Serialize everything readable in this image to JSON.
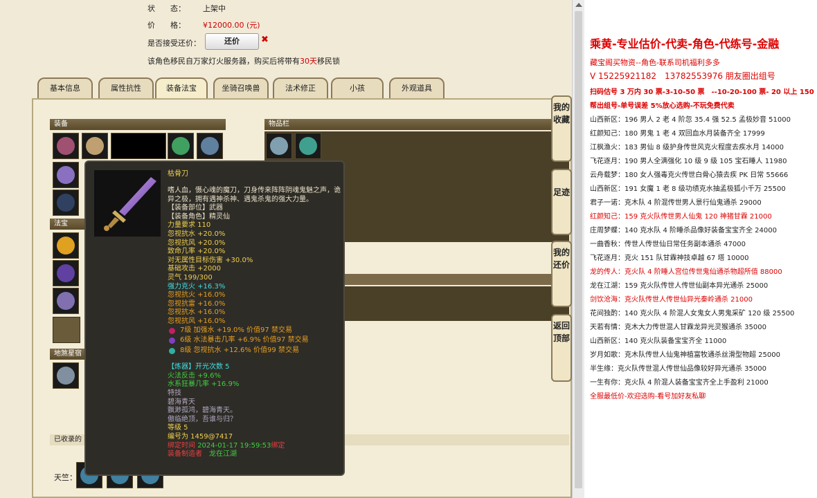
{
  "trade_info": {
    "status_label": "状　　态：",
    "status_value": "上架中",
    "price_label": "价　　格：",
    "price_value": "¥12000.00 (元)",
    "accept_offer_label": "是否接受还价：",
    "offer_button": "还价",
    "offer_x": "✖",
    "migration_prefix": "该角色移民自万家灯火服务器，购买后将带有",
    "migration_days": "30天",
    "migration_suffix": "移民锁"
  },
  "tabs": [
    "基本信息",
    "属性抗性",
    "装备法宝",
    "坐骑召唤兽",
    "法术修正",
    "小孩",
    "外观道具"
  ],
  "sections": {
    "equipment": "装备",
    "inventory": "物品栏",
    "treasure": "法宝",
    "reserved": "地煞星宿",
    "collected": "已收录的",
    "tianzhu": "天竺："
  },
  "side_buttons": [
    "我的收藏",
    "足迹",
    "我的还价",
    "返回顶部"
  ],
  "tooltip": {
    "name": "枯骨刀",
    "desc": "嗜人血，慑心魂的魔刀，刀身传来阵阵阴魂鬼魅之声，诡异之极，拥有遇神杀神、遇鬼杀鬼的强大力量。",
    "slot": "【装备部位】武器",
    "role": "【装备角色】精灵仙",
    "power_req": "力量要求 110",
    "stats_white": [
      "忽视抗水 +20.0%",
      "忽视抗风 +20.0%",
      "致命几率 +20.0%",
      "对无属性目标伤害 +30.0%",
      "基础攻击 +2000",
      "灵气 199/300"
    ],
    "stat_cyan": "强力克火 +16.3%",
    "stats_orange": [
      "忽视抗火 +16.0%",
      "忽视抗雷 +16.0%",
      "忽视抗水 +16.0%",
      "忽视抗风 +16.0%"
    ],
    "gems": [
      "7级 加强水 +19.0% 价值97 禁交易",
      "6级 水法暴击几率 +6.9% 价值97 禁交易",
      "8级 忽视抗水 +12.6% 价值99 禁交易"
    ],
    "forge_label": "【炼器】",
    "forge_value": "开光次数 5",
    "forge_stats": [
      "火法反击 +9.6%",
      "水系狂暴几率 +16.9%"
    ],
    "skill_label": "特技",
    "skill_name": "碧海青天",
    "poem": [
      "飘渺孤鸿，碧海青天。",
      "傲临绝顶，吾谁与归？"
    ],
    "level": "等级 5",
    "serial": "编号为 1459@7417",
    "bound_label": "绑定时间",
    "bound_time": "2024-01-17 19:59:53",
    "bound_tag": "绑定",
    "maker_label": "装备制造者",
    "maker": "龙在江湖"
  },
  "right_panel": {
    "title": "乘黄-专业估价-代卖-角色-代练号-金融",
    "sub1": "藏宝阁买物资--角色-联系司机福利多多",
    "phone": "V 15225921182　13782553976 朋友圈出组号",
    "promo1": "扫码估号 3 万内 30 票-3-10-50 票　--10-20-100 票- 20 以上 150",
    "promo2": "帮出组号-单号误差 5%放心选购-不玩免费代卖",
    "listings": [
      {
        "text": "山西新区：196 男人 2 老 4 阶忽 35.4 强 52.5 孟极妙音 51000",
        "red": false
      },
      {
        "text": "红颜知己：180 男鬼 1 老 4 双回血水月装备齐全 17999",
        "red": false
      },
      {
        "text": "江枫渔火：183 男仙 8 级护身传世风克火程度去疾水月 14000",
        "red": false
      },
      {
        "text": "飞花逐月：190 男人全满强化 10 级 9 级 105 宝石睡人 11980",
        "red": false
      },
      {
        "text": "云舟载梦：180 女人强毒克火传世白骨心猿去疾 PK 日常 55666",
        "red": false
      },
      {
        "text": "山西新区：191 女魔 1 老 8 级功绩克水抽孟极狐小千万 25500",
        "red": false
      },
      {
        "text": "君子一诺：克木队 4 阶混传世男人景行仙鬼通杀 29000",
        "red": false
      },
      {
        "text": "红颜知己：159 克火队传世男人仙鬼 120 神猪甘霖 21000",
        "red": true
      },
      {
        "text": "庄周梦蝶：140 克水队 4 阶睡杀品像好装备宝宝齐全 24000",
        "red": false
      },
      {
        "text": "一曲香秋：传世人传世仙日常任务副本通杀 47000",
        "red": false
      },
      {
        "text": "飞花逐月：克火 151 队甘霖神技卓越 67 塔 10000",
        "red": false
      },
      {
        "text": "龙的传人：克火队 4 阶睡人宫位传世鬼仙通杀物超所值 88000",
        "red": true
      },
      {
        "text": "龙在江湖：159 克火队传世人传世仙副本异光通杀 25000",
        "red": false
      },
      {
        "text": "剑饮沧海：克火队传世人传世仙异光秦岭通杀 21000",
        "red": true
      },
      {
        "text": "花间独酌：140 克火队 4 阶混人女鬼女人男鬼采矿 120 级 25500",
        "red": false
      },
      {
        "text": "天若有情：克木大力传世混人甘霖龙异光灵猴通杀 35000",
        "red": false
      },
      {
        "text": "山西新区：140 克火队装备宝宝齐全 11000",
        "red": false
      },
      {
        "text": "岁月如歌：克木队传世人仙鬼神植富牧通杀丝滑型物超 25000",
        "red": false
      },
      {
        "text": "半生缘：克火队传世混人传世仙品像较好异光通杀 35000",
        "red": false
      },
      {
        "text": "一生有你：克火队 4 阶混人装备宝宝齐全上手盈利 21000",
        "red": false
      },
      {
        "text": "全服最低价-欢迎选购-看号加好友私聊",
        "red": true
      }
    ]
  },
  "colors": {
    "panel_bg": "#f1ead7",
    "tooltip_bg": "#2e2c27",
    "price_red": "#cc0000",
    "accent_red": "#dd0000"
  }
}
